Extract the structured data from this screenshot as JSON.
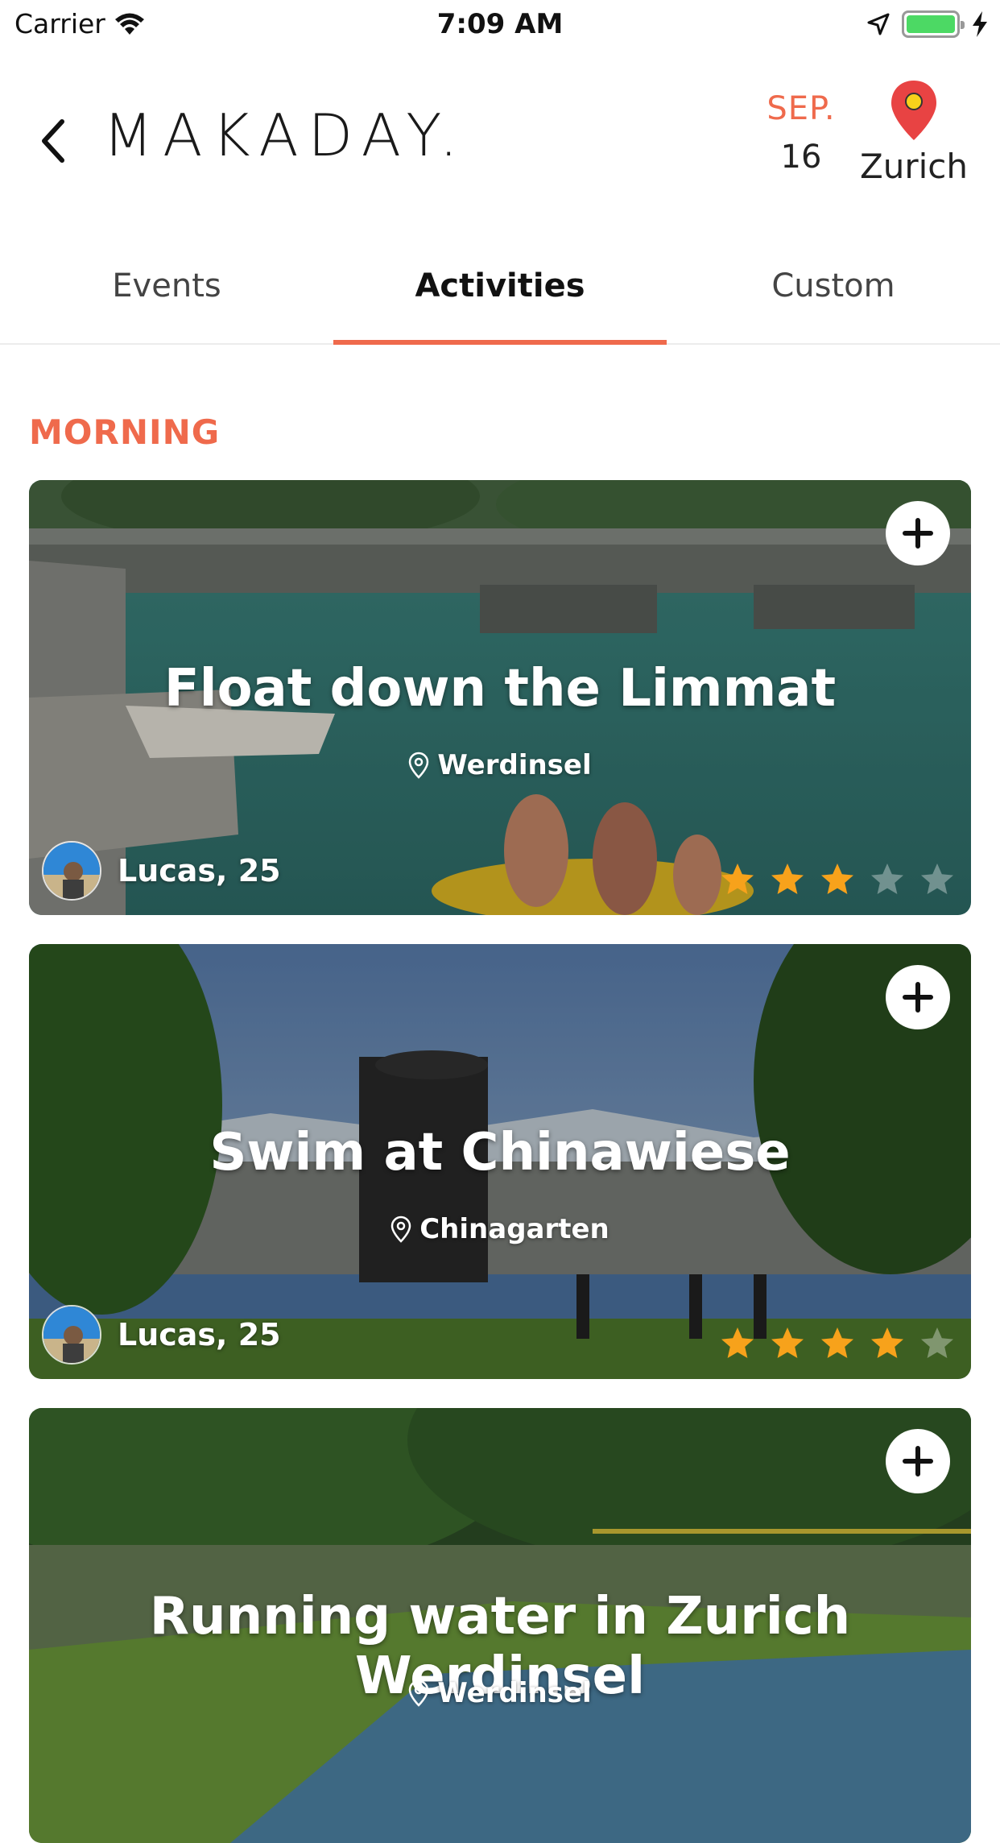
{
  "status_bar": {
    "carrier": "Carrier",
    "time": "7:09 AM"
  },
  "header": {
    "brand": "MAKADAY.",
    "date_month": "SEP.",
    "date_day": "16",
    "city": "Zurich"
  },
  "tabs": [
    {
      "label": "Events",
      "active": false
    },
    {
      "label": "Activities",
      "active": true
    },
    {
      "label": "Custom",
      "active": false
    }
  ],
  "section": {
    "label": "MORNING"
  },
  "cards": [
    {
      "title": "Float down the Limmat",
      "location": "Werdinsel",
      "author": "Lucas, 25",
      "rating": 3,
      "rating_max": 5
    },
    {
      "title": "Swim at Chinawiese",
      "location": "Chinagarten",
      "author": "Lucas, 25",
      "rating": 4,
      "rating_max": 5
    },
    {
      "title": "Running water in Zurich Werdinsel",
      "location": "Werdinsel"
    }
  ],
  "colors": {
    "accent": "#ef6a4c",
    "star": "#f7a21b",
    "star_empty": "rgba(255,255,255,0.35)"
  },
  "icons": [
    "back-chevron-icon",
    "map-pin-icon",
    "location-marker-icon",
    "plus-icon",
    "star-icon",
    "wifi-icon",
    "location-arrow-icon",
    "battery-icon",
    "charging-icon"
  ]
}
